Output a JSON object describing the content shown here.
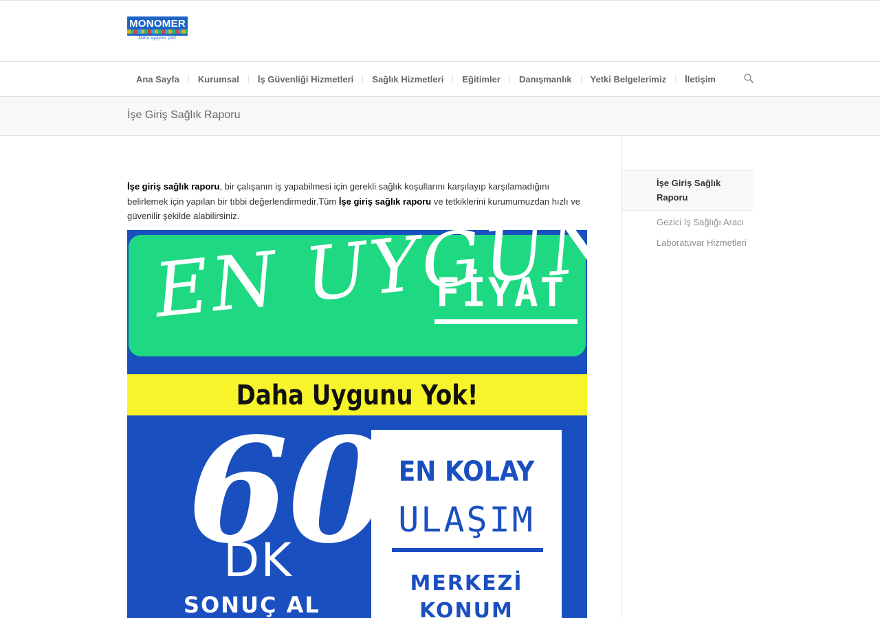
{
  "header": {
    "logo": {
      "text": "MONOMER",
      "tagline": "Daha uygunu yok!"
    },
    "nav": [
      {
        "label": "Ana Sayfa"
      },
      {
        "label": "Kurumsal"
      },
      {
        "label": "İş Güvenliği Hizmetleri"
      },
      {
        "label": "Sağlık Hizmetleri"
      },
      {
        "label": "Eğitimler"
      },
      {
        "label": "Danışmanlık"
      },
      {
        "label": "Yetki Belgelerimiz"
      },
      {
        "label": "İletişim"
      }
    ],
    "search_icon": "search-icon"
  },
  "page": {
    "title": "İşe Giriş Sağlık Raporu"
  },
  "content": {
    "p_bold1": "İşe giriş sağlık raporu",
    "p_text1": ", bir çalışanın iş yapabilmesi için gerekli sağlık koşullarını karşılayıp karşılamadığını belirlemek için yapılan bir tıbbi değerlendirmedir.Tüm ",
    "p_bold2": "İşe giriş sağlık raporu",
    "p_text2": " ve tetkiklerini kurumumuzdan hızlı ve güvenilir şekilde alabilirsiniz."
  },
  "promo": {
    "script_text": "EN UYGUN",
    "fiyat": "FİYAT",
    "daha_uygunu": "Daha Uygunu Yok!",
    "sixty": "60",
    "dk": "DK",
    "sonuc": "SONUÇ AL",
    "kolay": "EN KOLAY",
    "ulasim": "ULAŞIM",
    "merkezi": "MERKEZİ",
    "konum": "KONUM",
    "colors": {
      "blue": "#1a4fbf",
      "green": "#1ed882",
      "yellow": "#f7f42b"
    }
  },
  "sidebar": {
    "items": [
      {
        "label": "İşe Giriş Sağlık Raporu",
        "active": true
      },
      {
        "label": "Gezici İş Sağlığı Aracı",
        "active": false
      },
      {
        "label": "Laboratuvar Hizmetleri",
        "active": false
      }
    ]
  }
}
